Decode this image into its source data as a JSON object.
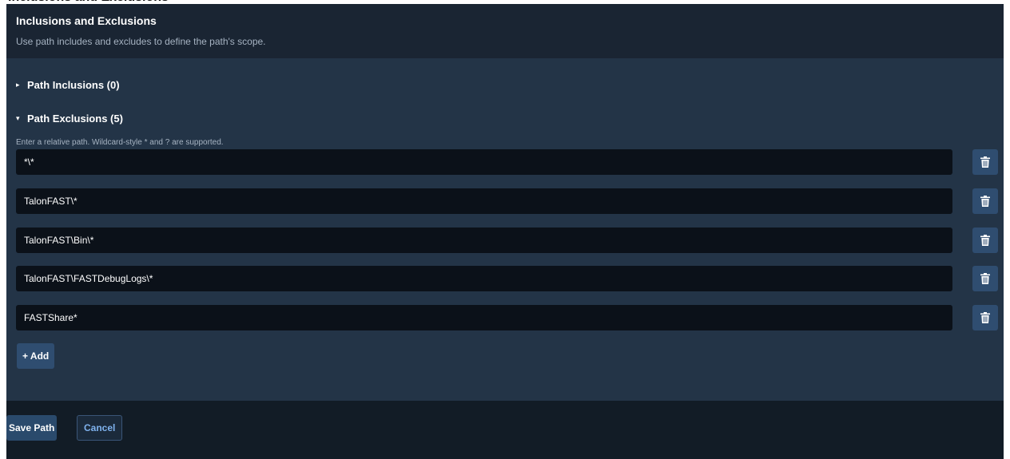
{
  "section": {
    "title": "Inclusions and Exclusions",
    "description": "Use path includes and excludes to define the path's scope."
  },
  "inclusions": {
    "label": "Path Inclusions (0)",
    "expanded": false,
    "caret": "▸"
  },
  "exclusions": {
    "label": "Path Exclusions (5)",
    "expanded": true,
    "caret": "▾",
    "hint": "Enter a relative path. Wildcard-style * and ? are supported.",
    "items": [
      {
        "value": "*\\*",
        "delete_icon": "trash-icon"
      },
      {
        "value": "TalonFAST\\*",
        "delete_icon": "trash-icon"
      },
      {
        "value": "TalonFAST\\Bin\\*",
        "delete_icon": "trash-icon"
      },
      {
        "value": "TalonFAST\\FASTDebugLogs\\*",
        "delete_icon": "trash-icon"
      },
      {
        "value": "FASTShare*",
        "delete_icon": "trash-icon"
      }
    ],
    "add_label": "+ Add"
  },
  "footer": {
    "save_label": "Save Path",
    "cancel_label": "Cancel"
  },
  "colors": {
    "panel_bg": "#233447",
    "header_bg": "#1a2533",
    "input_bg": "#0b1119",
    "button_bg": "#2f4d70",
    "cancel_text": "#7fb2ee"
  }
}
